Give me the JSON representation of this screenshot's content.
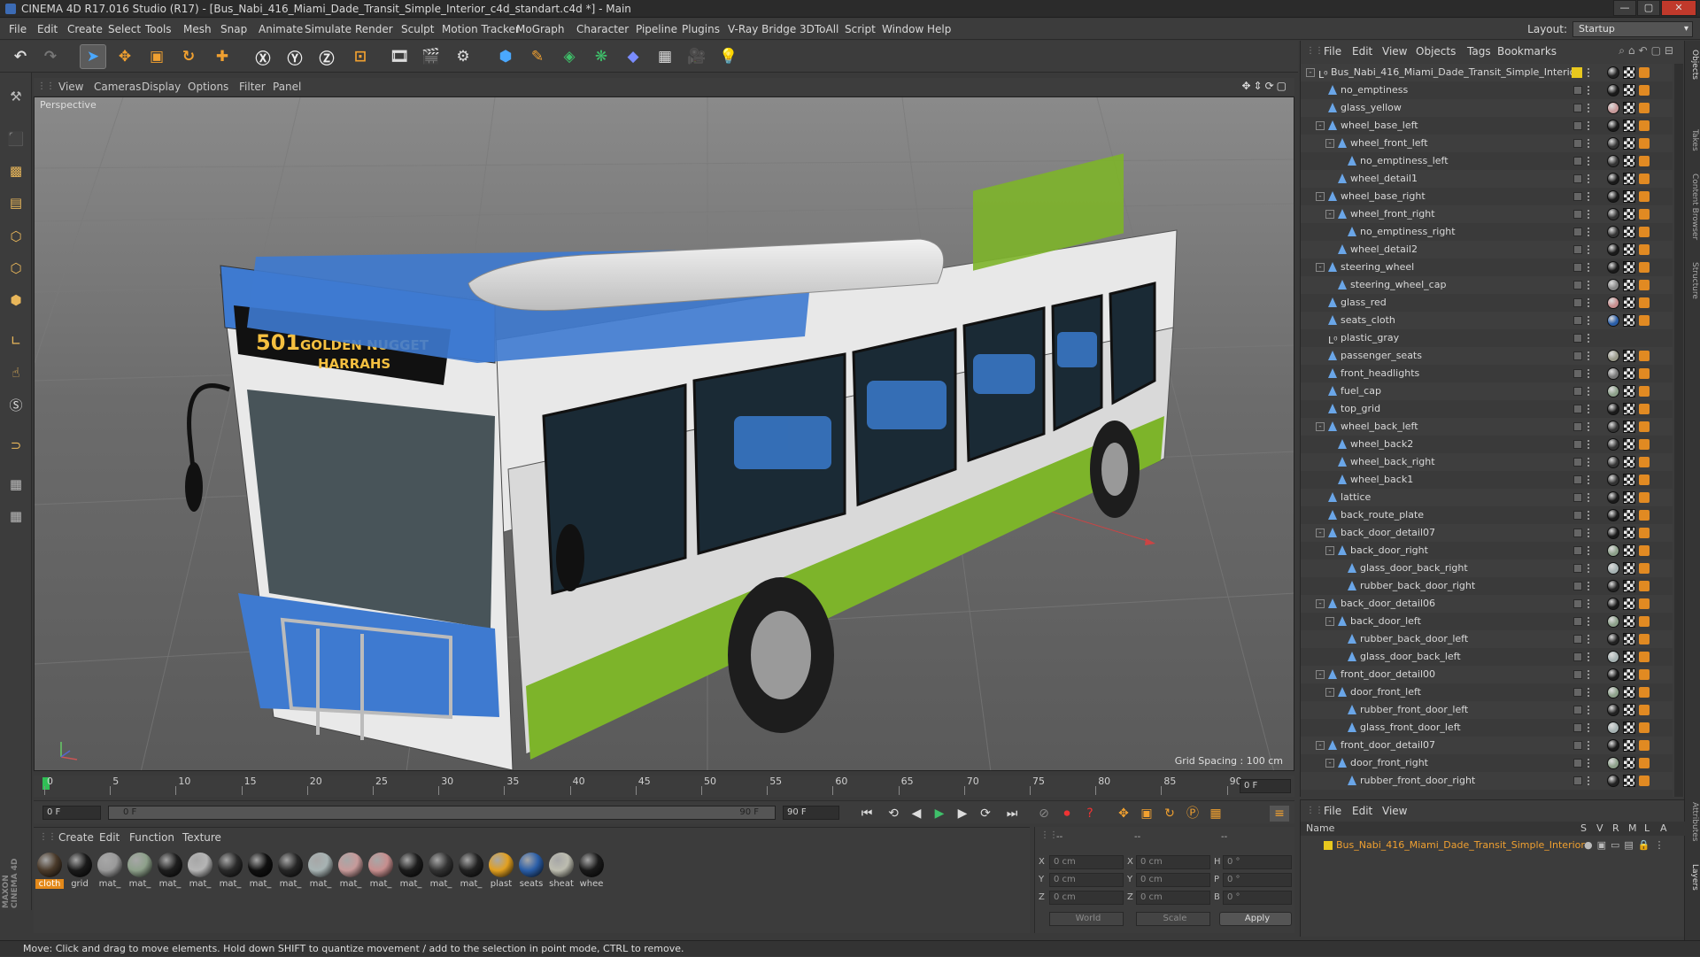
{
  "window": {
    "title": "CINEMA 4D R17.016 Studio (R17) - [Bus_Nabi_416_Miami_Dade_Transit_Simple_Interior_c4d_standart.c4d *] - Main"
  },
  "menu": [
    "File",
    "Edit",
    "Create",
    "Select",
    "Tools",
    "Mesh",
    "Snap",
    "Animate",
    "Simulate",
    "Render",
    "Sculpt",
    "Motion Tracker",
    "MoGraph",
    "Character",
    "Pipeline",
    "Plugins",
    "V-Ray Bridge",
    "3DToAll",
    "Script",
    "Window",
    "Help"
  ],
  "layout": {
    "label": "Layout:",
    "value": "Startup"
  },
  "viewport": {
    "menu": [
      "View",
      "Cameras",
      "Display",
      "Options",
      "Filter",
      "Panel"
    ],
    "label": "Perspective",
    "grid_spacing": "Grid Spacing : 100 cm",
    "bus_sign_number": "501",
    "bus_sign_line1": "GOLDEN NUGGET",
    "bus_sign_line2": "HARRAHS"
  },
  "timeline": {
    "ticks": [
      "0",
      "5",
      "10",
      "15",
      "20",
      "25",
      "30",
      "35",
      "40",
      "45",
      "50",
      "55",
      "60",
      "65",
      "70",
      "75",
      "80",
      "85",
      "90"
    ],
    "current_frame": "0 F",
    "start": "0 F",
    "range_start": "0 F",
    "range_end": "90 F",
    "end": "90 F"
  },
  "materials": {
    "menu": [
      "Create",
      "Edit",
      "Function",
      "Texture"
    ],
    "items": [
      {
        "label": "cloth",
        "color": "#4a3a2a"
      },
      {
        "label": "grid",
        "color": "#1a1a1a"
      },
      {
        "label": "mat_",
        "color": "#9a9a9a"
      },
      {
        "label": "mat_",
        "color": "#8da08a"
      },
      {
        "label": "mat_",
        "color": "#1e1e1e"
      },
      {
        "label": "mat_",
        "color": "#b5b5b5"
      },
      {
        "label": "mat_",
        "color": "#2a2a2a"
      },
      {
        "label": "mat_",
        "color": "#101010"
      },
      {
        "label": "mat_",
        "color": "#262626"
      },
      {
        "label": "mat_",
        "color": "#a7b3b3"
      },
      {
        "label": "mat_",
        "color": "#c79a9a"
      },
      {
        "label": "mat_",
        "color": "#c78e8e"
      },
      {
        "label": "mat_",
        "color": "#1c1c1c"
      },
      {
        "label": "mat_",
        "color": "#333333"
      },
      {
        "label": "mat_",
        "color": "#222222"
      },
      {
        "label": "plast",
        "color": "#e2a020"
      },
      {
        "label": "seats",
        "color": "#2a5ea8"
      },
      {
        "label": "sheat",
        "color": "#bdbdb0"
      },
      {
        "label": "whee",
        "color": "#1a1a1a"
      }
    ]
  },
  "coords": {
    "header": [
      "--",
      "--",
      "--"
    ],
    "x": "0 cm",
    "y": "0 cm",
    "z": "0 cm",
    "sx": "0 cm",
    "sy": "0 cm",
    "sz": "0 cm",
    "h": "0 °",
    "p": "0 °",
    "b": "0 °",
    "mode1": "World",
    "mode2": "Scale",
    "apply": "Apply"
  },
  "status": "Move: Click and drag to move elements. Hold down SHIFT to quantize movement / add to the selection in point mode, CTRL to remove.",
  "objects": {
    "menu": [
      "File",
      "Edit",
      "View",
      "Objects",
      "Tags",
      "Bookmarks"
    ],
    "rows": [
      {
        "name": "Bus_Nabi_416_Miami_Dade_Transit_Simple_Interior",
        "level": 0,
        "exp": "-",
        "icon": "null",
        "tag": "#222"
      },
      {
        "name": "no_emptiness",
        "level": 1,
        "exp": "",
        "tag": "#1a1a1a"
      },
      {
        "name": "glass_yellow",
        "level": 1,
        "exp": "",
        "tag": "#c79a9a"
      },
      {
        "name": "wheel_base_left",
        "level": 1,
        "exp": "-",
        "tag": "#1a1a1a"
      },
      {
        "name": "wheel_front_left",
        "level": 2,
        "exp": "-",
        "tag": "#333"
      },
      {
        "name": "no_emptiness_left",
        "level": 3,
        "exp": "",
        "tag": "#333"
      },
      {
        "name": "wheel_detail1",
        "level": 2,
        "exp": "",
        "tag": "#1a1a1a"
      },
      {
        "name": "wheel_base_right",
        "level": 1,
        "exp": "-",
        "tag": "#1a1a1a"
      },
      {
        "name": "wheel_front_right",
        "level": 2,
        "exp": "-",
        "tag": "#333"
      },
      {
        "name": "no_emptiness_right",
        "level": 3,
        "exp": "",
        "tag": "#333"
      },
      {
        "name": "wheel_detail2",
        "level": 2,
        "exp": "",
        "tag": "#1a1a1a"
      },
      {
        "name": "steering_wheel",
        "level": 1,
        "exp": "-",
        "tag": "#1a1a1a"
      },
      {
        "name": "steering_wheel_cap",
        "level": 2,
        "exp": "",
        "tag": "#888"
      },
      {
        "name": "glass_red",
        "level": 1,
        "exp": "",
        "tag": "#c78e8e"
      },
      {
        "name": "seats_cloth",
        "level": 1,
        "exp": "",
        "tag": "#2a5ea8"
      },
      {
        "name": "plastic_gray",
        "level": 1,
        "exp": "",
        "tag": "",
        "icon": "null"
      },
      {
        "name": "passenger_seats",
        "level": 1,
        "exp": "",
        "tag": "#9a9a8a"
      },
      {
        "name": "front_headlights",
        "level": 1,
        "exp": "",
        "tag": "#777"
      },
      {
        "name": "fuel_cap",
        "level": 1,
        "exp": "",
        "tag": "#8da08a"
      },
      {
        "name": "top_grid",
        "level": 1,
        "exp": "",
        "tag": "#1a1a1a"
      },
      {
        "name": "wheel_back_left",
        "level": 1,
        "exp": "-",
        "tag": "#333"
      },
      {
        "name": "wheel_back2",
        "level": 2,
        "exp": "",
        "tag": "#333"
      },
      {
        "name": "wheel_back_right",
        "level": 2,
        "exp": "",
        "tag": "#333"
      },
      {
        "name": "wheel_back1",
        "level": 2,
        "exp": "",
        "tag": "#333"
      },
      {
        "name": "lattice",
        "level": 1,
        "exp": "",
        "tag": "#1a1a1a"
      },
      {
        "name": "back_route_plate",
        "level": 1,
        "exp": "",
        "tag": "#1a1a1a"
      },
      {
        "name": "back_door_detail07",
        "level": 1,
        "exp": "-",
        "tag": "#1a1a1a"
      },
      {
        "name": "back_door_right",
        "level": 2,
        "exp": "-",
        "tag": "#8da08a"
      },
      {
        "name": "glass_door_back_right",
        "level": 3,
        "exp": "",
        "tag": "#a7b3b3"
      },
      {
        "name": "rubber_back_door_right",
        "level": 3,
        "exp": "",
        "tag": "#222"
      },
      {
        "name": "back_door_detail06",
        "level": 1,
        "exp": "-",
        "tag": "#1a1a1a"
      },
      {
        "name": "back_door_left",
        "level": 2,
        "exp": "-",
        "tag": "#8da08a"
      },
      {
        "name": "rubber_back_door_left",
        "level": 3,
        "exp": "",
        "tag": "#222"
      },
      {
        "name": "glass_door_back_left",
        "level": 3,
        "exp": "",
        "tag": "#a7b3b3"
      },
      {
        "name": "front_door_detail00",
        "level": 1,
        "exp": "-",
        "tag": "#1a1a1a"
      },
      {
        "name": "door_front_left",
        "level": 2,
        "exp": "-",
        "tag": "#8da08a"
      },
      {
        "name": "rubber_front_door_left",
        "level": 3,
        "exp": "",
        "tag": "#222"
      },
      {
        "name": "glass_front_door_left",
        "level": 3,
        "exp": "",
        "tag": "#a7b3b3"
      },
      {
        "name": "front_door_detail07",
        "level": 1,
        "exp": "-",
        "tag": "#1a1a1a"
      },
      {
        "name": "door_front_right",
        "level": 2,
        "exp": "-",
        "tag": "#8da08a"
      },
      {
        "name": "rubber_front_door_right",
        "level": 3,
        "exp": "",
        "tag": "#222"
      }
    ]
  },
  "layers": {
    "menu": [
      "File",
      "Edit",
      "View"
    ],
    "header_name": "Name",
    "cols": [
      "S",
      "V",
      "R",
      "M",
      "L",
      "A"
    ],
    "row_name": "Bus_Nabi_416_Miami_Dade_Transit_Simple_Interior"
  },
  "side_tabs": [
    "Objects",
    "Takes",
    "Content Browser",
    "Structure"
  ],
  "side_tabs2": [
    "Attributes",
    "Layers"
  ],
  "brand": "MAXON CINEMA 4D"
}
